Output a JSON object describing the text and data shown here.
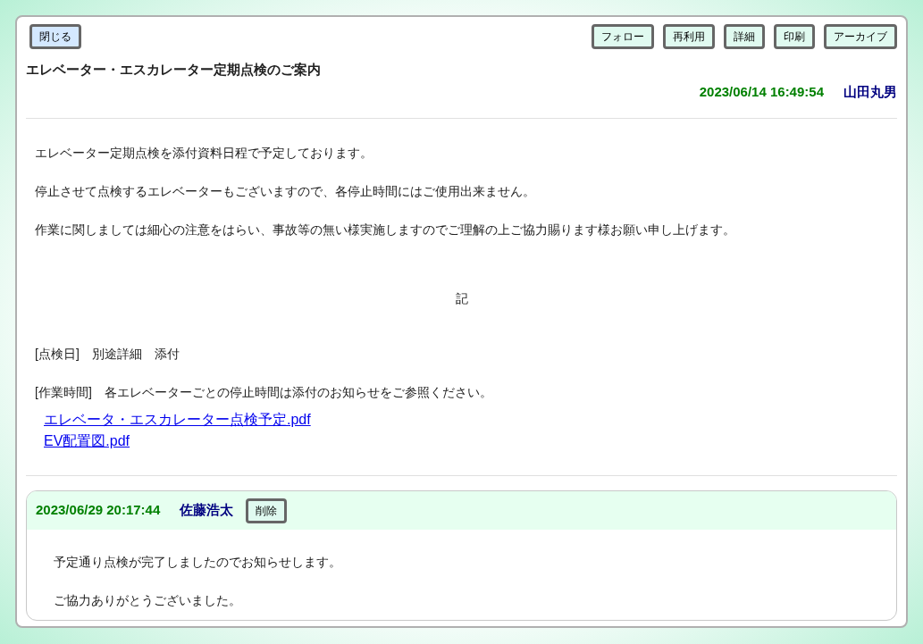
{
  "close_button": "閉じる",
  "toolbar": [
    "フォロー",
    "再利用",
    "詳細",
    "印刷",
    "アーカイブ"
  ],
  "title": "エレベーター・エスカレーター定期点検のご案内",
  "posted_at": "2023/06/14 16:49:54",
  "author": "山田丸男",
  "body": [
    {
      "kind": "text",
      "text": "エレベーター定期点検を添付資料日程で予定しております。"
    },
    {
      "kind": "text",
      "text": "停止させて点検するエレベーターもございますので、各停止時間にはご使用出来ません。"
    },
    {
      "kind": "text",
      "text": "作業に関しましては細心の注意をはらい、事故等の無い様実施しますのでご理解の上ご協力賜ります様お願い申し上げます。"
    },
    {
      "kind": "center",
      "text": "記"
    },
    {
      "kind": "item",
      "text": "[点検日]　別途詳細　添付"
    },
    {
      "kind": "item",
      "text": "[作業時間]　各エレベーターごとの停止時間は添付のお知らせをご参照ください。"
    }
  ],
  "attachments": [
    "エレベータ・エスカレーター点検予定.pdf",
    "EV配置図.pdf"
  ],
  "comments": [
    {
      "posted_at": "2023/06/29 20:17:44",
      "author": "佐藤浩太",
      "delete_button": "削除",
      "lines": [
        "予定通り点検が完了しましたのでお知らせします。",
        "ご協力ありがとうございました。"
      ]
    }
  ]
}
